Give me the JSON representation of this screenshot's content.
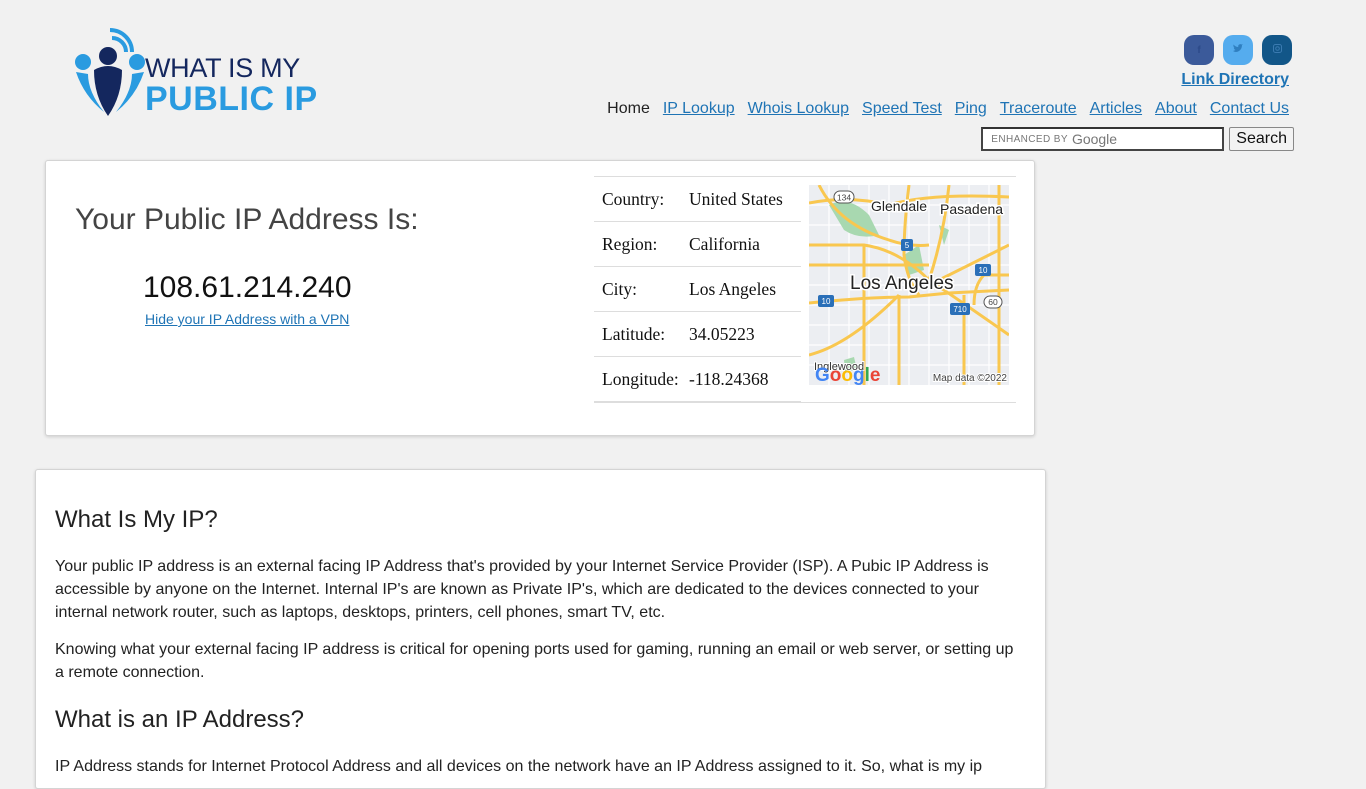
{
  "header": {
    "logo": {
      "line1": "WHAT IS MY",
      "line2": "PUBLIC IP",
      "colors": {
        "dark": "#14275e",
        "light": "#2a9be0"
      }
    },
    "social": [
      {
        "name": "facebook",
        "glyph": "f",
        "color": "#3b5a9a"
      },
      {
        "name": "twitter",
        "glyph": "🐦",
        "color": "#55acee"
      },
      {
        "name": "instagram",
        "glyph": "◎",
        "color": "#125688"
      }
    ],
    "link_directory": "Link Directory",
    "nav": [
      {
        "label": "Home",
        "active": true
      },
      {
        "label": "IP Lookup"
      },
      {
        "label": "Whois Lookup"
      },
      {
        "label": "Speed Test"
      },
      {
        "label": "Ping"
      },
      {
        "label": "Traceroute"
      },
      {
        "label": "Articles"
      },
      {
        "label": "About"
      },
      {
        "label": "Contact Us"
      }
    ],
    "search": {
      "placeholder_prefix": "ENHANCED BY",
      "placeholder_brand": "Google",
      "button": "Search"
    }
  },
  "ip_card": {
    "heading": "Your Public IP Address Is:",
    "ip": "108.61.214.240",
    "vpn_link": "Hide your IP Address with a VPN",
    "geo": [
      {
        "label": "Country:",
        "value": "United States"
      },
      {
        "label": "Region:",
        "value": "California"
      },
      {
        "label": "City:",
        "value": "Los Angeles"
      },
      {
        "label": "Latitude:",
        "value": "34.05223"
      },
      {
        "label": "Longitude:",
        "value": "-118.24368"
      }
    ],
    "map": {
      "city_label": "Los Angeles",
      "places": [
        "Glendale",
        "Pasadena",
        "Inglewood"
      ],
      "shields": [
        "134",
        "5",
        "10",
        "10",
        "710",
        "60"
      ],
      "attribution": "Map data ©2022",
      "brand": "Google"
    }
  },
  "article": {
    "heading1": "What Is My IP?",
    "para1": "Your public IP address is an external facing IP Address that's provided by your Internet Service Provider (ISP). A Pubic IP Address is accessible by anyone on the Internet. Internal IP's are known as Private IP's, which are dedicated to the devices connected to your internal network router, such as laptops, desktops, printers, cell phones, smart TV, etc.",
    "para2": "Knowing what your external facing IP address is critical for opening ports used for gaming, running an email or web server, or setting up a remote connection.",
    "heading2": "What is an IP Address?",
    "para3": "IP Address stands for Internet Protocol Address and all devices on the network have an IP Address assigned to it. So, what is my ip"
  }
}
